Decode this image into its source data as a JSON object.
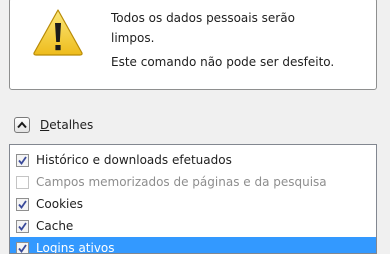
{
  "warning": {
    "icon": "warning-icon",
    "message_line1": "Todos os dados pessoais serão",
    "message_line1b": "limpos.",
    "message_line2": "Este comando não pode ser desfeito.",
    "icon_color": "#f5d03a"
  },
  "details": {
    "label_mnemonic": "D",
    "label_rest": "etalhes",
    "expanded": true
  },
  "checklist": {
    "items": [
      {
        "label": "Histórico e downloads efetuados",
        "checked": true,
        "enabled": true,
        "selected": false
      },
      {
        "label": "Campos memorizados de páginas e da pesquisa",
        "checked": false,
        "enabled": false,
        "selected": false
      },
      {
        "label": "Cookies",
        "checked": true,
        "enabled": true,
        "selected": false
      },
      {
        "label": "Cache",
        "checked": true,
        "enabled": true,
        "selected": false
      },
      {
        "label": "Logins ativos",
        "checked": true,
        "enabled": true,
        "selected": true
      }
    ]
  },
  "colors": {
    "selection": "#3399ff",
    "check_mark": "#3a4a9a"
  }
}
